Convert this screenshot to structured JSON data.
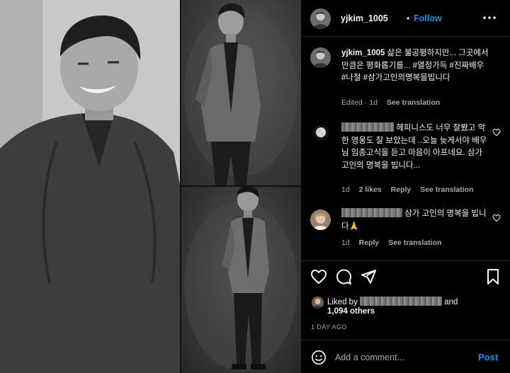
{
  "post": {
    "username": "yjkim_1005",
    "separator": "•",
    "follow_label": "Follow",
    "more_icon": "more-horizontal-icon"
  },
  "caption": {
    "username": "yjkim_1005",
    "text": "삶은 불공평하지만... 그곳에서 만큼은 평화롭기를... #열정가득 #진짜배우 #나철 #삼가고인의명복을빕니다",
    "edited": "Edited",
    "sep": "·",
    "age": "1d",
    "see_translation": "See translation"
  },
  "comments": [
    {
      "text": "헤피니스도 너무 잘봤고 악한 영웅도 잘 보았는데 ..오늘 늦게서야 배우님 임종고식을 듣고 마음이 아프네요. 삼가고인의 명복을 빕니다...",
      "age": "1d",
      "likes": "2 likes",
      "reply": "Reply",
      "see_translation": "See translation"
    },
    {
      "text": "삼가 고인의 명복을 빕니다🙏",
      "age": "1d",
      "reply": "Reply",
      "see_translation": "See translation"
    }
  ],
  "likes": {
    "liked_by": "Liked by",
    "and": "and",
    "others": "1,094 others"
  },
  "date": "1 DAY AGO",
  "add_comment": {
    "placeholder": "Add a comment...",
    "post_label": "Post"
  },
  "colors": {
    "accent": "#0095f6",
    "muted": "#a8a8a8",
    "divider": "#262626"
  }
}
